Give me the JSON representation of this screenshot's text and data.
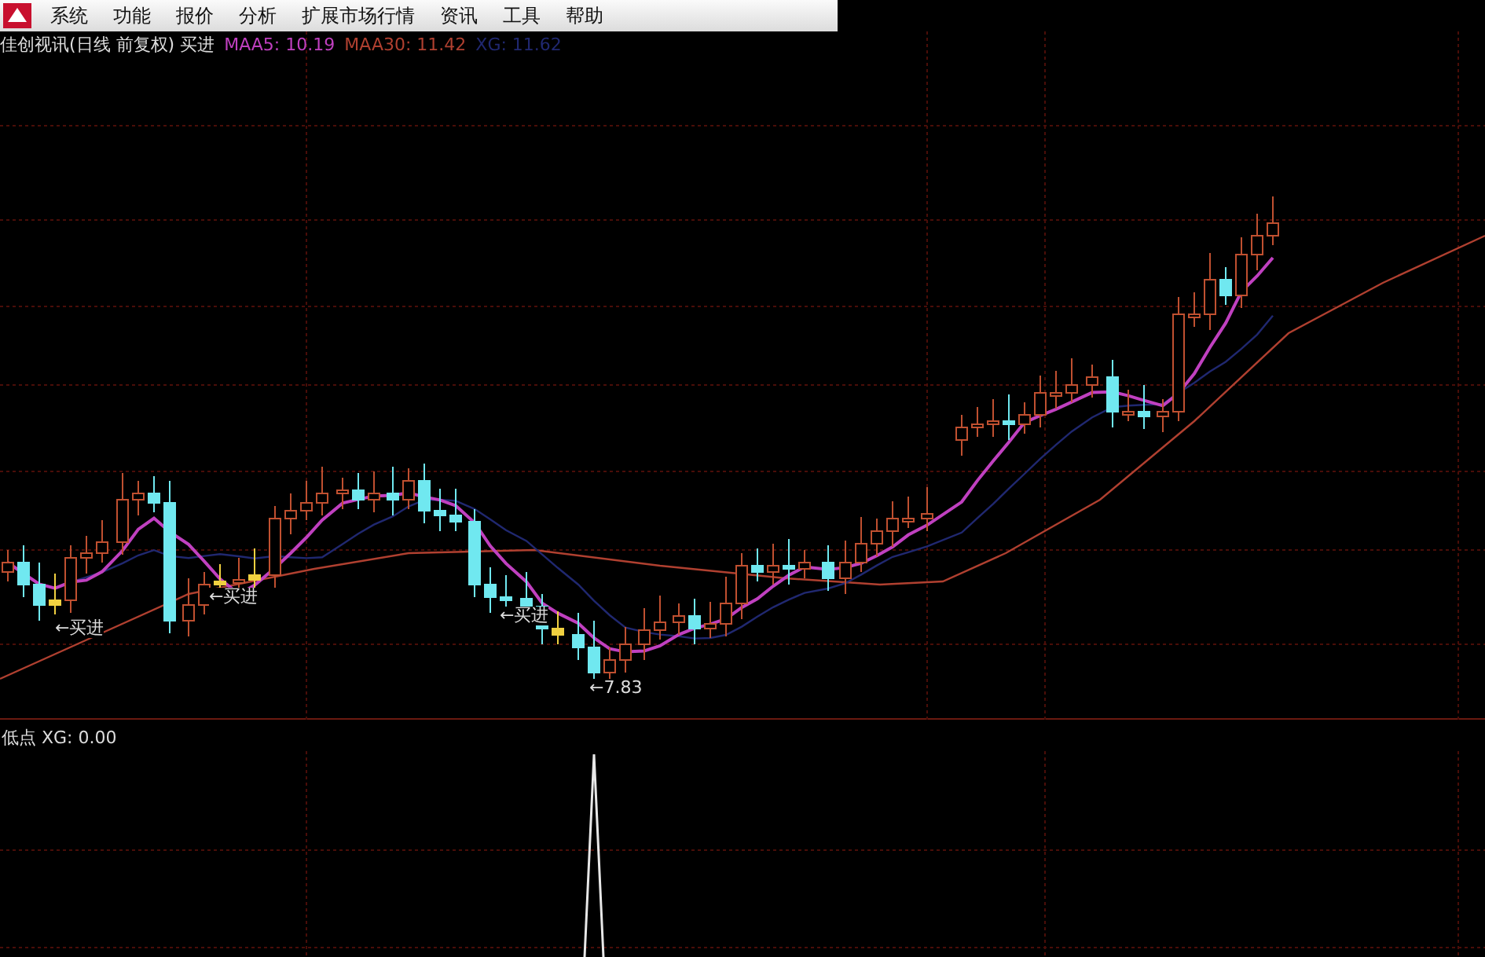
{
  "menu_bar": {
    "items": [
      "系统",
      "功能",
      "报价",
      "分析",
      "扩展市场行情",
      "资讯",
      "工具",
      "帮助"
    ]
  },
  "main_chart": {
    "title": "佳创视讯(日线 前复权) 买进",
    "indicators": [
      {
        "label": "MAA5: 10.19",
        "color": "#c040c0"
      },
      {
        "label": "MAA30: 11.42",
        "color": "#b04030"
      },
      {
        "label": "XG: 11.62",
        "color": "#202870"
      }
    ],
    "signals": [
      "←买进",
      "←买进",
      "←买进"
    ],
    "low_label": "←7.83"
  },
  "sub_chart": {
    "title": "低点 XG: 0.00"
  }
}
